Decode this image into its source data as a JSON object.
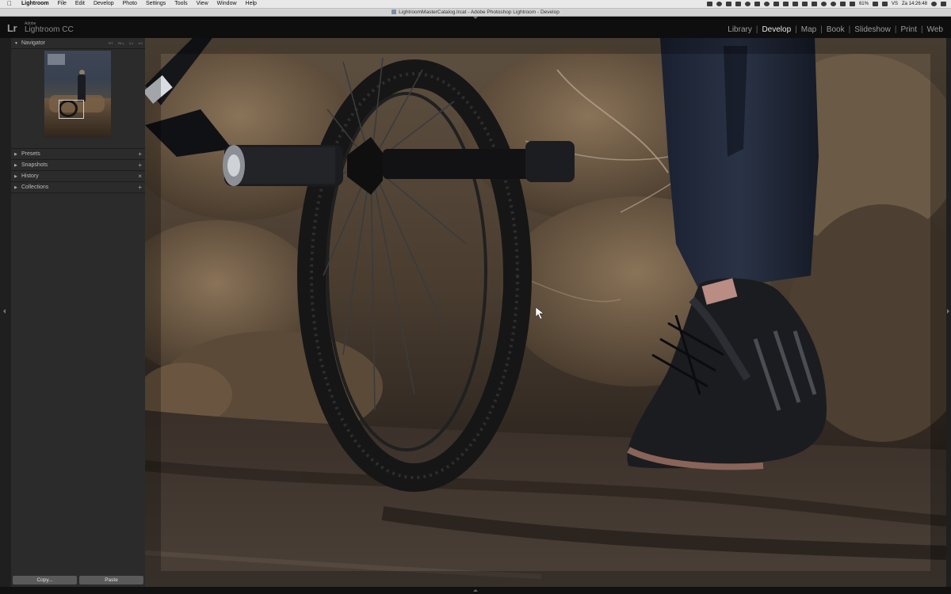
{
  "menubar": {
    "app_name": "Lightroom",
    "items": [
      "File",
      "Edit",
      "Develop",
      "Photo",
      "Settings",
      "Tools",
      "View",
      "Window",
      "Help"
    ],
    "battery": "61%",
    "input_source": "VS",
    "clock": "Za 14:26:48"
  },
  "window": {
    "title": "LightroomMasterCatalog.lrcat - Adobe Photoshop Lightroom - Develop"
  },
  "identity_plate": {
    "logo": "Lr",
    "vendor": "Adobe",
    "product": "Lightroom CC"
  },
  "modules": {
    "items": [
      "Library",
      "Develop",
      "Map",
      "Book",
      "Slideshow",
      "Print",
      "Web"
    ],
    "active": "Develop"
  },
  "left_panel": {
    "navigator": {
      "title": "Navigator",
      "zoom_options": [
        "FIT",
        "FILL",
        "1:1",
        "4:1"
      ]
    },
    "sections": [
      {
        "label": "Presets",
        "action": "+"
      },
      {
        "label": "Snapshots",
        "action": "+"
      },
      {
        "label": "History",
        "action": "×"
      },
      {
        "label": "Collections",
        "action": "+"
      }
    ],
    "copy_label": "Copy...",
    "paste_label": "Paste"
  },
  "colors": {
    "panel_bg": "#2b2b2b",
    "topbar_bg": "#0e0e0e",
    "active_module": "#e6e6e6",
    "inactive_module": "#9c9c9c"
  }
}
